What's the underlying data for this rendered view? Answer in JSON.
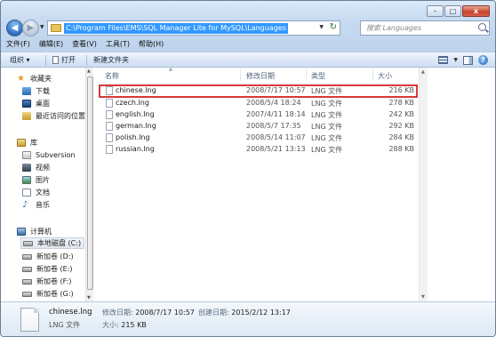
{
  "window": {
    "buttons": {
      "minimize": "–",
      "maximize": "□",
      "close": "x"
    }
  },
  "address": {
    "path": "C:\\Program Files\\EMS\\SQL Manager Lite for MySQL\\Languages",
    "search_placeholder": "搜索 Languages"
  },
  "menu": [
    "文件(F)",
    "编辑(E)",
    "查看(V)",
    "工具(T)",
    "帮助(H)"
  ],
  "toolbar": {
    "organize": "组织 ▾",
    "open": "打开",
    "new_folder": "新建文件夹"
  },
  "nav": {
    "favorites": "收藏夹",
    "downloads": "下载",
    "desktop": "桌面",
    "recent": "最近访问的位置",
    "libraries": "库",
    "subversion": "Subversion",
    "videos": "视频",
    "pictures": "图片",
    "documents": "文档",
    "music": "音乐",
    "computer": "计算机",
    "drive_c": "本地磁盘 (C:)",
    "drive_d": "新加卷 (D:)",
    "drive_e": "新加卷 (E:)",
    "drive_f": "新加卷 (F:)",
    "drive_g": "新加卷 (G:)"
  },
  "columns": {
    "name": "名称",
    "modified": "修改日期",
    "type": "类型",
    "size": "大小"
  },
  "files": [
    {
      "name": "chinese.lng",
      "modified": "2008/7/17 10:57",
      "type": "LNG 文件",
      "size": "216 KB"
    },
    {
      "name": "czech.lng",
      "modified": "2008/5/4 18:24",
      "type": "LNG 文件",
      "size": "278 KB"
    },
    {
      "name": "english.lng",
      "modified": "2007/4/11 18:14",
      "type": "LNG 文件",
      "size": "242 KB"
    },
    {
      "name": "german.lng",
      "modified": "2008/5/7 17:35",
      "type": "LNG 文件",
      "size": "292 KB"
    },
    {
      "name": "polish.lng",
      "modified": "2008/5/14 11:07",
      "type": "LNG 文件",
      "size": "284 KB"
    },
    {
      "name": "russian.lng",
      "modified": "2008/5/21 13:13",
      "type": "LNG 文件",
      "size": "288 KB"
    }
  ],
  "details": {
    "name": "chinese.lng",
    "type": "LNG 文件",
    "modified_label": "修改日期:",
    "modified": "2008/7/17 10:57",
    "size_label": "大小:",
    "size": "215 KB",
    "created_label": "创建日期:",
    "created": "2015/2/12 13:17"
  },
  "colors": {
    "highlight_border": "#d63a3a",
    "address_selection": "#3399ff"
  }
}
